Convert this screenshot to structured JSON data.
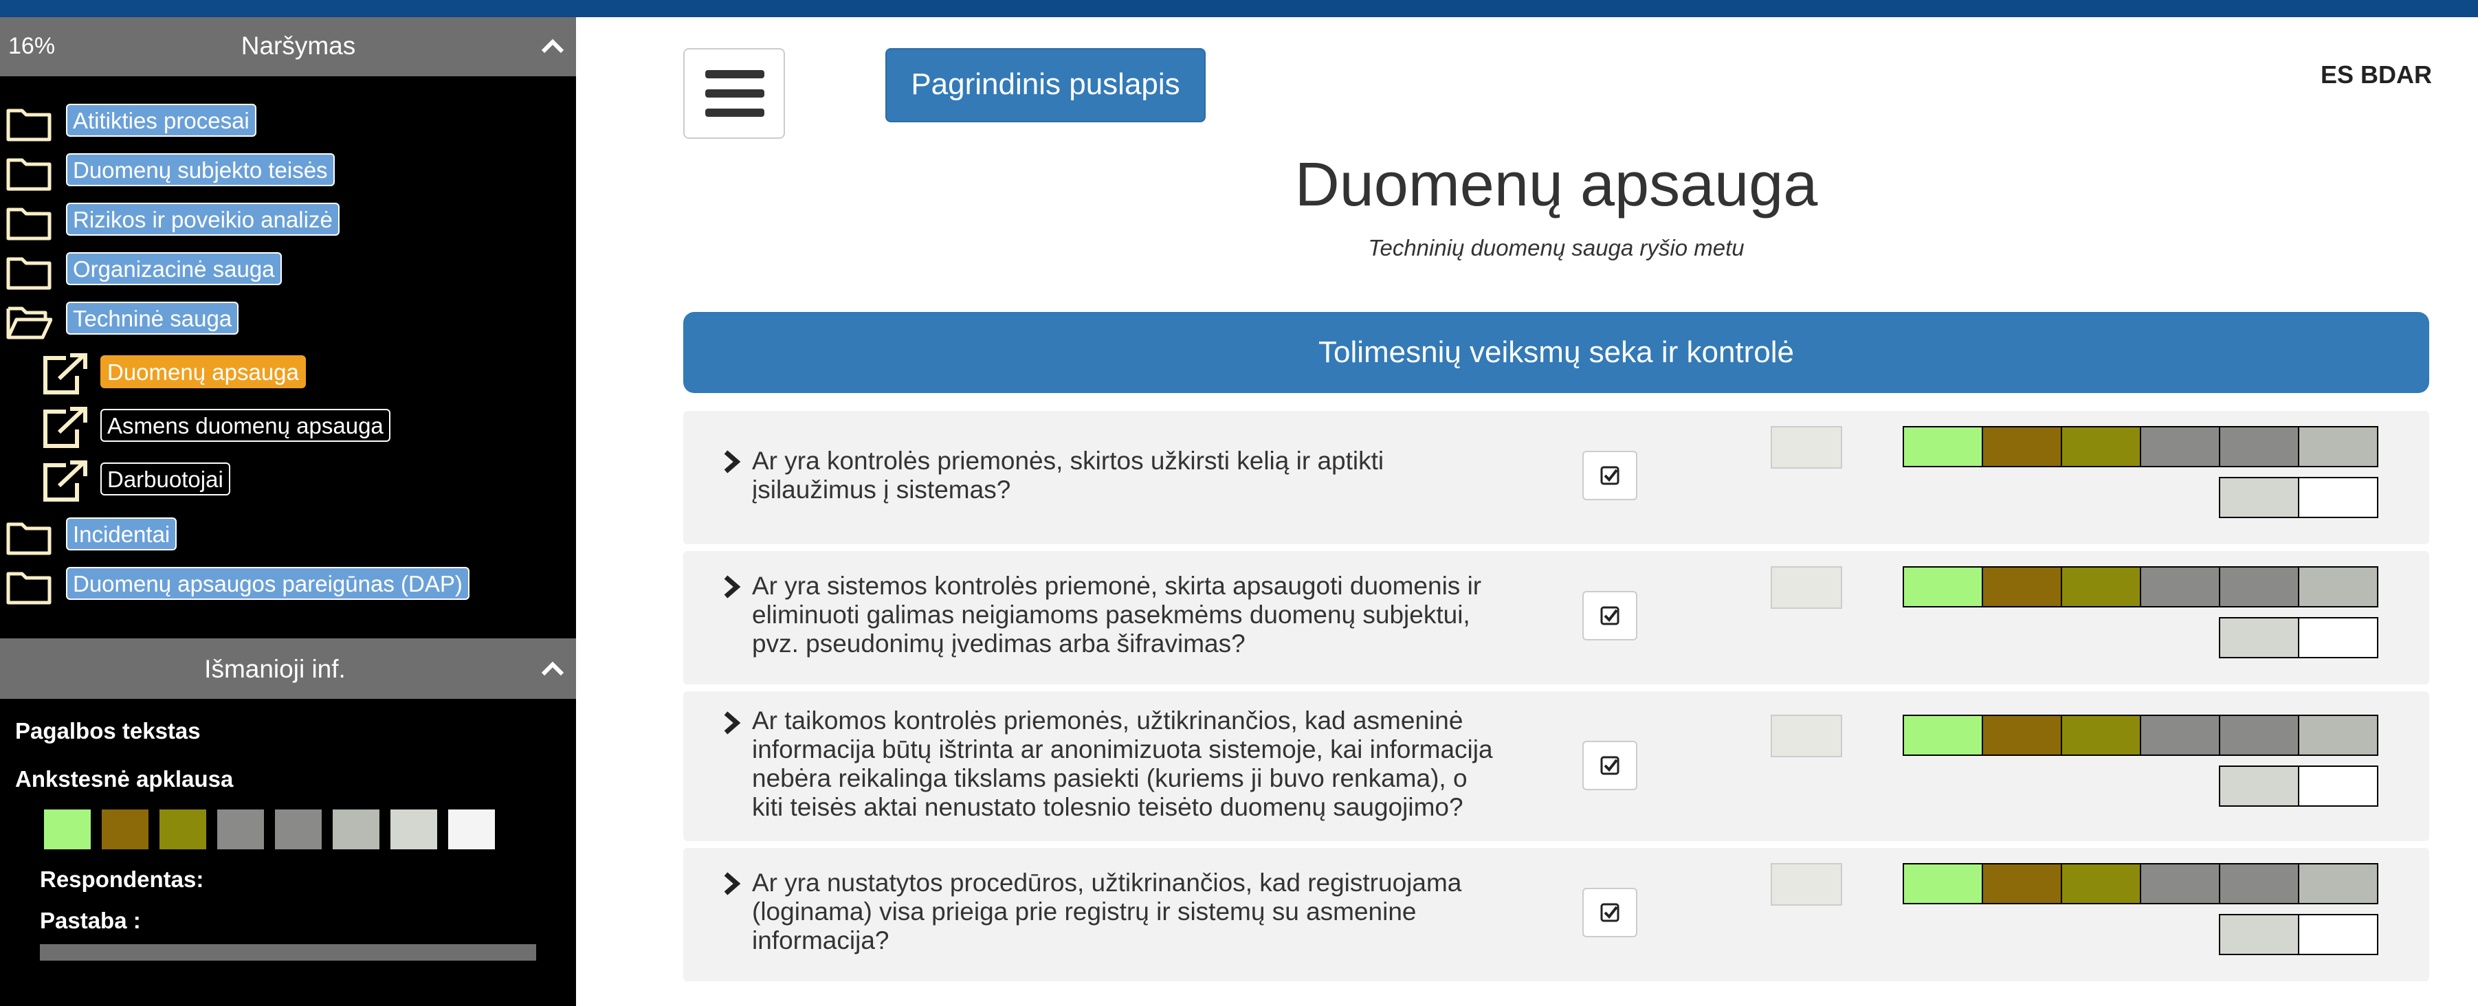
{
  "sidebar": {
    "nav_header": {
      "percent": "16%",
      "title": "Naršymas"
    },
    "items": [
      {
        "label": "Atitikties procesai",
        "type": "folder"
      },
      {
        "label": "Duomenų subjekto teisės",
        "type": "folder"
      },
      {
        "label": "Rizikos ir poveikio analizė",
        "type": "folder"
      },
      {
        "label": "Organizacinė sauga",
        "type": "folder"
      },
      {
        "label": "Techninė sauga",
        "type": "folder-open"
      },
      {
        "label": "Duomenų apsauga",
        "type": "link",
        "active": true
      },
      {
        "label": "Asmens duomenų apsauga",
        "type": "link"
      },
      {
        "label": "Darbuotojai",
        "type": "link"
      },
      {
        "label": "Incidentai",
        "type": "folder"
      },
      {
        "label": "Duomenų apsaugos pareigūnas (DAP)",
        "type": "folder"
      }
    ],
    "info_header": {
      "title": "Išmanioji inf."
    },
    "info": {
      "help_text": "Pagalbos tekstas",
      "previous_survey": "Ankstesnė apklausa",
      "respondent": "Respondentas:",
      "note": "Pastaba :"
    },
    "swatches": [
      "#a6f57f",
      "#8c6a0a",
      "#8c8a0a",
      "#8a8a88",
      "#8a8b88",
      "#b8bab4",
      "#d4d6d0",
      "#f4f4f4"
    ]
  },
  "main": {
    "home_button": "Pagrindinis puslapis",
    "top_right": "ES BDAR",
    "title": "Duomenų apsauga",
    "subtitle": "Techninių duomenų sauga ryšio metu",
    "section": "Tolimesnių veiksmų seka ir kontrolė",
    "questions": [
      {
        "line1": "Ar yra kontrolės priemonės, skirtos užkirsti kelią ir aptikti",
        "line2": "įsilaužimus į sistemas?",
        "line3": "",
        "line4": "",
        "line5": ""
      },
      {
        "line1": "Ar yra sistemos kontrolės priemonė, skirta apsaugoti duomenis ir",
        "line2": "eliminuoti galimas neigiamoms pasekmėms duomenų subjektui,",
        "line3": "pvz. pseudonimų įvedimas arba šifravimas?",
        "line4": "",
        "line5": ""
      },
      {
        "line1": "Ar taikomos kontrolės priemonės, užtikrinančios, kad asmeninė",
        "line2": "informacija būtų ištrinta ar anonimizuota sistemoje, kai informacija",
        "line3": "nebėra reikalinga tikslams pasiekti (kuriems ji buvo renkama), o",
        "line4": "kiti teisės aktai nenustato tolesnio teisėto duomenų saugojimo?",
        "line5": ""
      },
      {
        "line1": "Ar yra nustatytos procedūros, užtikrinančios, kad registruojama",
        "line2": "(loginama) visa prieiga prie registrų ir sistemų su asmenine",
        "line3": "informacija?",
        "line4": "",
        "line5": ""
      }
    ],
    "scale_colors": [
      "#a6f57f",
      "#8c6a0a",
      "#8c8a0a",
      "#8a8a88",
      "#8a8b88",
      "#b8bab4"
    ],
    "scale2_colors": [
      "#d4d6d0",
      "#ffffff"
    ]
  },
  "colors": {
    "topbar": "#0d4a87",
    "primary": "#337ab7",
    "active": "#f0a020"
  }
}
